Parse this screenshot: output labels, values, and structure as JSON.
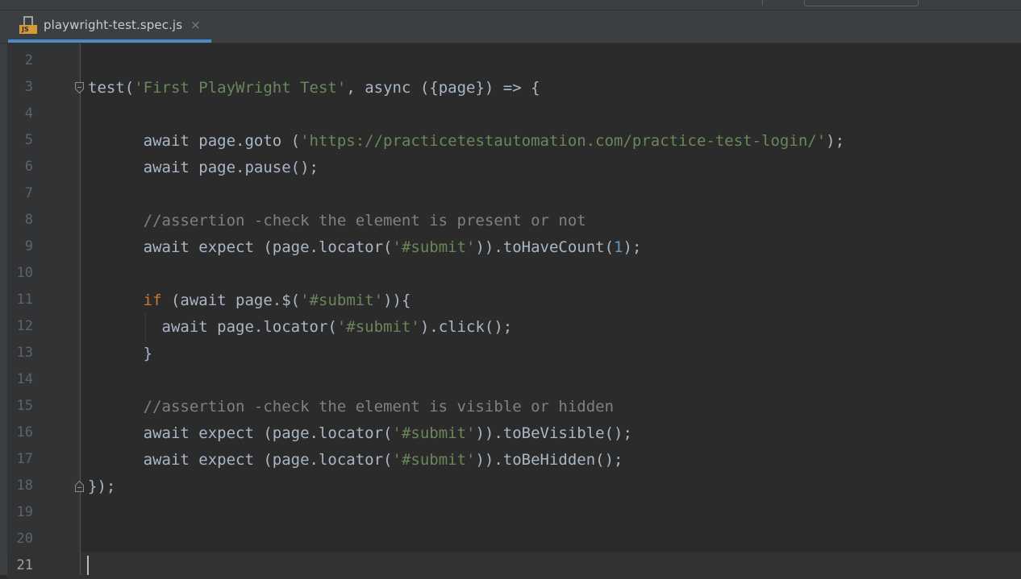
{
  "tab": {
    "filename": "playwright-test.spec.js",
    "icon": "js-file-icon",
    "icon_badge": "JS",
    "close_glyph": "×"
  },
  "colors": {
    "background": "#2b2b2b",
    "gutter": "#313335",
    "text": "#a9b7c6",
    "string": "#6a8759",
    "keyword": "#cc7832",
    "number": "#6897bb",
    "comment": "#808080",
    "tab_underline": "#4a88c7"
  },
  "editor": {
    "current_line": "21",
    "lines": [
      {
        "number": "2",
        "segments": []
      },
      {
        "number": "3",
        "fold": "fold-start",
        "segments": [
          {
            "t": "test(",
            "c": "plain"
          },
          {
            "t": "'First PlayWright Test'",
            "c": "str"
          },
          {
            "t": ", async ({page}) => {",
            "c": "plain"
          }
        ]
      },
      {
        "number": "4",
        "segments": []
      },
      {
        "number": "5",
        "segments": [
          {
            "t": "      await page.goto (",
            "c": "plain"
          },
          {
            "t": "'https://practicetestautomation.com/practice-test-login/'",
            "c": "str"
          },
          {
            "t": ");",
            "c": "plain"
          }
        ]
      },
      {
        "number": "6",
        "segments": [
          {
            "t": "      await page.pause();",
            "c": "plain"
          }
        ]
      },
      {
        "number": "7",
        "segments": []
      },
      {
        "number": "8",
        "segments": [
          {
            "t": "      //assertion -check the element is present or not",
            "c": "cmt"
          }
        ]
      },
      {
        "number": "9",
        "segments": [
          {
            "t": "      await expect (page.locator(",
            "c": "plain"
          },
          {
            "t": "'#submit'",
            "c": "str"
          },
          {
            "t": ")).toHaveCount(",
            "c": "plain"
          },
          {
            "t": "1",
            "c": "num"
          },
          {
            "t": ");",
            "c": "plain"
          }
        ]
      },
      {
        "number": "10",
        "segments": []
      },
      {
        "number": "11",
        "segments": [
          {
            "t": "      ",
            "c": "plain"
          },
          {
            "t": "if",
            "c": "kw"
          },
          {
            "t": " (await page.$(",
            "c": "plain"
          },
          {
            "t": "'#submit'",
            "c": "str"
          },
          {
            "t": ")){",
            "c": "plain"
          }
        ]
      },
      {
        "number": "12",
        "segments": [
          {
            "t": "        await page.locator(",
            "c": "plain"
          },
          {
            "t": "'#submit'",
            "c": "str"
          },
          {
            "t": ").click();",
            "c": "plain"
          }
        ]
      },
      {
        "number": "13",
        "segments": [
          {
            "t": "      }",
            "c": "plain"
          }
        ]
      },
      {
        "number": "14",
        "segments": []
      },
      {
        "number": "15",
        "segments": [
          {
            "t": "      //assertion -check the element is visible or hidden",
            "c": "cmt"
          }
        ]
      },
      {
        "number": "16",
        "segments": [
          {
            "t": "      await expect (page.locator(",
            "c": "plain"
          },
          {
            "t": "'#submit'",
            "c": "str"
          },
          {
            "t": ")).toBeVisible();",
            "c": "plain"
          }
        ]
      },
      {
        "number": "17",
        "segments": [
          {
            "t": "      await expect (page.locator(",
            "c": "plain"
          },
          {
            "t": "'#submit'",
            "c": "str"
          },
          {
            "t": ")).toBeHidden();",
            "c": "plain"
          }
        ]
      },
      {
        "number": "18",
        "fold": "fold-end",
        "segments": [
          {
            "t": "});",
            "c": "plain"
          }
        ]
      },
      {
        "number": "19",
        "segments": []
      },
      {
        "number": "20",
        "segments": []
      },
      {
        "number": "21",
        "segments": []
      }
    ]
  }
}
